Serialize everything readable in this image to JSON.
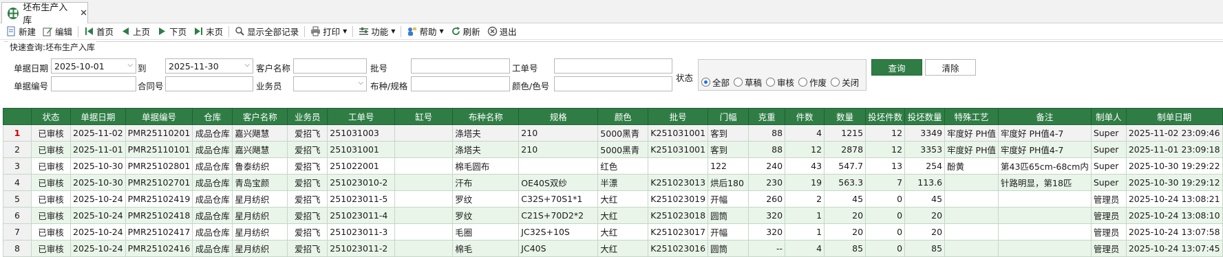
{
  "tab": {
    "title": "坯布生产入库",
    "close": "✕"
  },
  "toolbar": [
    {
      "label": "新建",
      "icon": "new-icon"
    },
    {
      "label": "编辑",
      "icon": "edit-icon"
    },
    {
      "label": "首页",
      "icon": "first-page-icon"
    },
    {
      "label": "上页",
      "icon": "prev-page-icon"
    },
    {
      "label": "下页",
      "icon": "next-page-icon"
    },
    {
      "label": "末页",
      "icon": "last-page-icon"
    },
    {
      "label": "显示全部记录",
      "icon": "show-all-icon"
    },
    {
      "label": "打印",
      "icon": "print-icon"
    },
    {
      "label": "功能",
      "icon": "function-icon"
    },
    {
      "label": "帮助",
      "icon": "help-icon"
    },
    {
      "label": "刷新",
      "icon": "refresh-icon"
    },
    {
      "label": "退出",
      "icon": "exit-icon"
    }
  ],
  "query": {
    "title": "快速查询:坯布生产入库",
    "doc_date_label": "单据日期",
    "date_from": "2025-10-01",
    "to_label": "到",
    "date_to": "2025-11-30",
    "customer_label": "客户名称",
    "batch_label": "批号",
    "job_label": "工单号",
    "doc_no_label": "单据编号",
    "contract_label": "合同号",
    "salesman_label": "业务员",
    "fabric_label": "布种/规格",
    "color_label": "颜色/色号",
    "status_label": "状态",
    "status_options": [
      "全部",
      "草稿",
      "审核",
      "作废",
      "关闭"
    ],
    "query_button": "查询",
    "clear_button": "清除"
  },
  "grid": {
    "columns": [
      "状态",
      "单据日期",
      "单据编号",
      "仓库",
      "客户名称",
      "业务员",
      "工单号",
      "缸号",
      "布种名称",
      "规格",
      "颜色",
      "批号",
      "门幅",
      "克重",
      "件数",
      "数量",
      "投坯件数",
      "投坯数量",
      "特殊工艺",
      "备注",
      "制单人",
      "制单日期"
    ],
    "rows": [
      [
        "1",
        "已审核",
        "2025-11-02",
        "PMR25110201",
        "成品仓库",
        "嘉兴飓慧",
        "爱招飞",
        "251031003",
        "",
        "涤塔夫",
        "210",
        "5000黑青",
        "K251031001",
        "客到",
        "88",
        "4",
        "1215",
        "12",
        "3349",
        "牢度好  PH值",
        "牢度好  PH值4-7",
        "Super",
        "2025-11-02 23:09:46"
      ],
      [
        "2",
        "已审核",
        "2025-11-01",
        "PMR25110101",
        "成品仓库",
        "嘉兴飓慧",
        "爱招飞",
        "251031001",
        "",
        "涤塔夫",
        "210",
        "5000黑青",
        "K251031001",
        "客到",
        "88",
        "12",
        "2878",
        "12",
        "3353",
        "牢度好  PH值",
        "牢度好  PH值4-7",
        "Super",
        "2025-11-01 23:09:18"
      ],
      [
        "3",
        "已审核",
        "2025-10-30",
        "PMR25102801",
        "成品仓库",
        "鲁泰纺织",
        "爱招飞",
        "251022001",
        "",
        "棉毛圆布",
        "",
        "红色",
        "",
        "122",
        "240",
        "43",
        "547.7",
        "13",
        "254",
        "酚黄",
        "第43匹65cm-68cm内",
        "Super",
        "2025-10-30 19:29:22"
      ],
      [
        "4",
        "已审核",
        "2025-10-30",
        "PMR25102701",
        "成品仓库",
        "青岛宝颜",
        "爱招飞",
        "251023010-2",
        "",
        "汗布",
        "OE40S双纱",
        "半漂",
        "K251023013",
        "烘后180",
        "230",
        "19",
        "563.3",
        "7",
        "113.6",
        "",
        "针路明显，第18匹",
        "Super",
        "2025-10-30 19:29:12"
      ],
      [
        "5",
        "已审核",
        "2025-10-24",
        "PMR25102419",
        "成品仓库",
        "星月纺织",
        "爱招飞",
        "251023011-5",
        "",
        "罗纹",
        "C32S+70S1*1",
        "大红",
        "K251023019",
        "开幅",
        "260",
        "2",
        "45",
        "0",
        "45",
        "",
        "",
        "管理员",
        "2025-10-24 13:08:21"
      ],
      [
        "6",
        "已审核",
        "2025-10-24",
        "PMR25102418",
        "成品仓库",
        "星月纺织",
        "爱招飞",
        "251023011-4",
        "",
        "罗纹",
        "C21S+70D2*2",
        "大红",
        "K251023018",
        "圆筒",
        "320",
        "1",
        "20",
        "0",
        "20",
        "",
        "",
        "管理员",
        "2025-10-24 13:08:10"
      ],
      [
        "7",
        "已审核",
        "2025-10-24",
        "PMR25102417",
        "成品仓库",
        "星月纺织",
        "爱招飞",
        "251023011-3",
        "",
        "毛圈",
        "JC32S+10S",
        "大红",
        "K251023017",
        "开幅",
        "320",
        "1",
        "20",
        "0",
        "20",
        "",
        "",
        "管理员",
        "2025-10-24 13:07:58"
      ],
      [
        "8",
        "已审核",
        "2025-10-24",
        "PMR25102416",
        "成品仓库",
        "星月纺织",
        "爱招飞",
        "251023011-2",
        "",
        "棉毛",
        "JC40S",
        "大红",
        "K251023016",
        "圆筒",
        "--",
        "4",
        "85",
        "0",
        "85",
        "",
        "",
        "管理员",
        "2025-10-24 13:07:45"
      ]
    ]
  },
  "colors": {
    "accent": "#2f7d45",
    "selected_rownum": "#d00000"
  }
}
